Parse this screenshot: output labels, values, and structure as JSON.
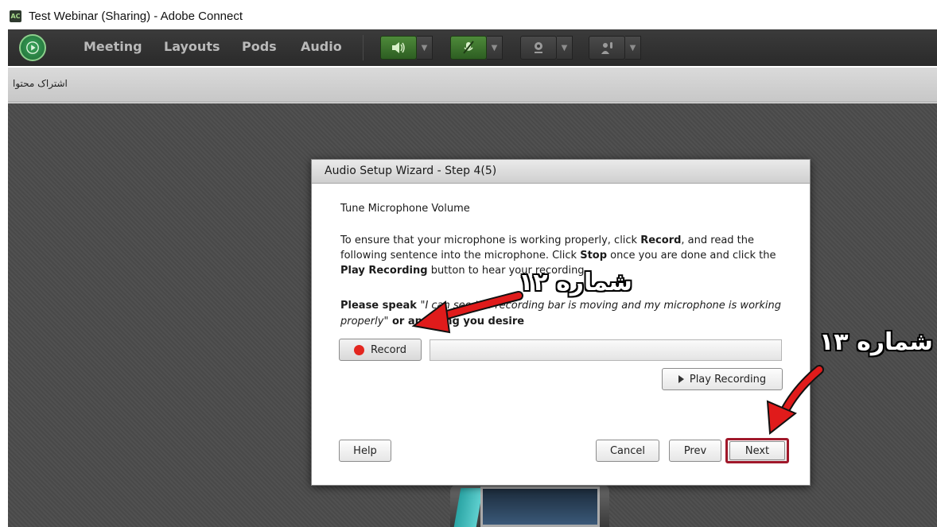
{
  "window": {
    "title": "Test Webinar (Sharing) - Adobe Connect",
    "icon": "adobe-connect-icon"
  },
  "menubar": {
    "items": [
      "Meeting",
      "Layouts",
      "Pods",
      "Audio"
    ],
    "toolbar_icons": [
      "speaker-icon",
      "microphone-muted-icon",
      "webcam-icon",
      "raise-hand-icon"
    ],
    "accent_color": "#3f7a2f"
  },
  "pod": {
    "title": "اشتراک محتوا"
  },
  "dialog": {
    "title": "Audio Setup Wizard - Step 4(5)",
    "heading": "Tune Microphone Volume",
    "instructions": {
      "p1": "To ensure that your microphone is working properly, click ",
      "record_word": "Record",
      "p2": ", and read the following sentence into the microphone. Click ",
      "stop_word": "Stop",
      "p3": " once you are done and click the ",
      "play_word": "Play Recording",
      "p4": " button to hear your recording."
    },
    "speak": {
      "prefix": "Please speak ",
      "quote": "\"I can see the recording bar is moving and my microphone is working properly\"",
      "suffix": " or anything you desire"
    },
    "record_button": "Record",
    "play_button": "Play Recording",
    "help_button": "Help",
    "cancel_button": "Cancel",
    "prev_button": "Prev",
    "next_button": "Next"
  },
  "annotations": {
    "label_12": "شماره ۱۲",
    "label_13": "شماره ۱۳",
    "arrow_color": "#e01b1b",
    "highlight_color": "#a0182a"
  }
}
